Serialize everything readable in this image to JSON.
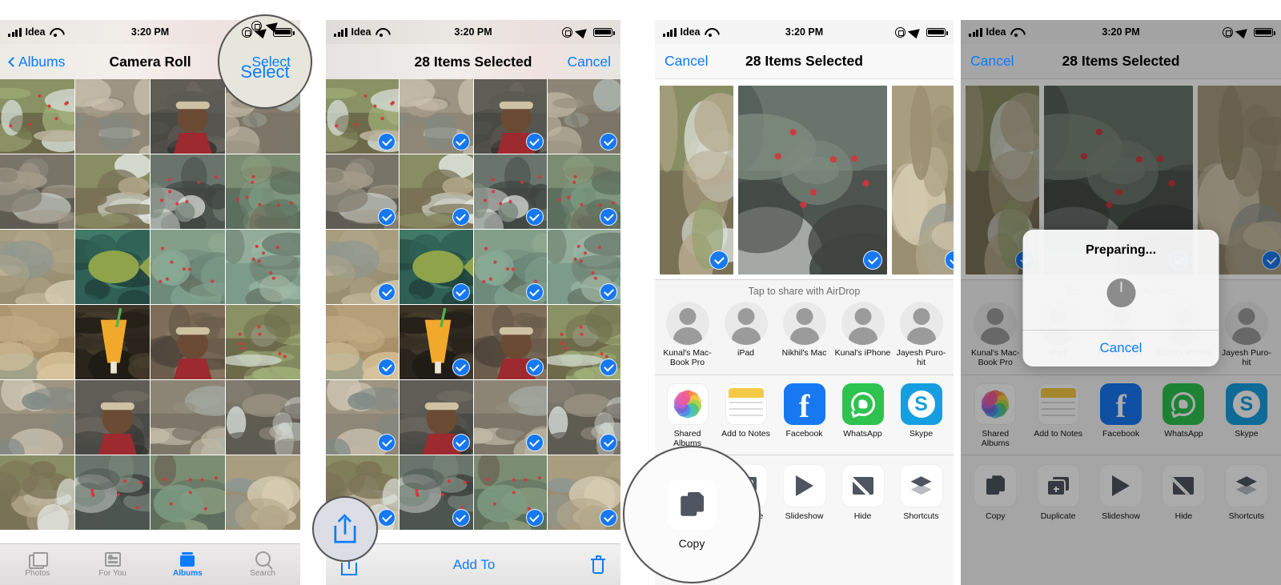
{
  "status_bar": {
    "carrier": "Idea",
    "time": "3:20 PM"
  },
  "panels": [
    {
      "id": "camera-roll",
      "nav": {
        "back_label": "Albums",
        "title": "Camera Roll",
        "right_label": "Select"
      },
      "tab_bar": [
        {
          "label": "Photos",
          "icon": "photos-icon",
          "active": false
        },
        {
          "label": "For You",
          "icon": "for-you-icon",
          "active": false
        },
        {
          "label": "Albums",
          "icon": "albums-icon",
          "active": true
        },
        {
          "label": "Search",
          "icon": "search-icon",
          "active": false
        }
      ],
      "highlight": {
        "label": "Select",
        "target": "select-button"
      }
    },
    {
      "id": "items-selected",
      "nav": {
        "title": "28 Items Selected",
        "right_label": "Cancel"
      },
      "action_bar": {
        "share_icon": "share-icon",
        "add_to_label": "Add To",
        "trash_icon": "trash-icon"
      },
      "highlight": {
        "target": "share-button"
      }
    },
    {
      "id": "share-sheet",
      "nav": {
        "left_label": "Cancel",
        "title": "28 Items Selected"
      },
      "airdrop": {
        "title": "Tap to share with AirDrop",
        "contacts": [
          "Kunal's Mac-Book Pro",
          "iPad",
          "Nikhil's Mac",
          "Kunal's iPhone",
          "Jayesh Puro-hit"
        ]
      },
      "apps": [
        {
          "label": "Shared Albums",
          "icon": "shared-albums-icon"
        },
        {
          "label": "Add to Notes",
          "icon": "notes-icon"
        },
        {
          "label": "Facebook",
          "icon": "facebook-icon"
        },
        {
          "label": "WhatsApp",
          "icon": "whatsapp-icon"
        },
        {
          "label": "Skype",
          "icon": "skype-icon"
        }
      ],
      "actions": [
        {
          "label": "Copy",
          "icon": "copy-icon"
        },
        {
          "label": "Duplicate",
          "icon": "duplicate-icon"
        },
        {
          "label": "Slideshow",
          "icon": "slideshow-icon"
        },
        {
          "label": "Hide",
          "icon": "hide-icon"
        },
        {
          "label": "Shortcuts",
          "icon": "shortcuts-icon"
        }
      ],
      "highlight": {
        "label": "Copy",
        "target": "copy-action"
      }
    },
    {
      "id": "preparing",
      "nav": {
        "left_label": "Cancel",
        "title": "28 Items Selected"
      },
      "airdrop": {
        "title": "Tap to share with AirDrop",
        "contacts": [
          "Kunal's Mac-Book Pro",
          "iPad",
          "Nikhil's Mac",
          "Kunal's iPhone",
          "Jayesh Puro-hit"
        ]
      },
      "apps": [
        {
          "label": "Shared Albums",
          "icon": "shared-albums-icon"
        },
        {
          "label": "Add to Notes",
          "icon": "notes-icon"
        },
        {
          "label": "Facebook",
          "icon": "facebook-icon"
        },
        {
          "label": "WhatsApp",
          "icon": "whatsapp-icon"
        },
        {
          "label": "Skype",
          "icon": "skype-icon"
        }
      ],
      "actions": [
        {
          "label": "Copy",
          "icon": "copy-icon"
        },
        {
          "label": "Duplicate",
          "icon": "duplicate-icon"
        },
        {
          "label": "Slideshow",
          "icon": "slideshow-icon"
        },
        {
          "label": "Hide",
          "icon": "hide-icon"
        },
        {
          "label": "Shortcuts",
          "icon": "shortcuts-icon"
        }
      ],
      "modal": {
        "title": "Preparing...",
        "cancel_label": "Cancel",
        "spinner": "activity-spinner"
      }
    }
  ],
  "colors": {
    "accent_blue": "#0a7cff",
    "check_blue": "#1678f2",
    "facebook": "#1778f2",
    "whatsapp": "#2ec24f",
    "skype": "#169fe0",
    "notes_yellow": "#f6c944",
    "action_gray": "#4e5560"
  }
}
